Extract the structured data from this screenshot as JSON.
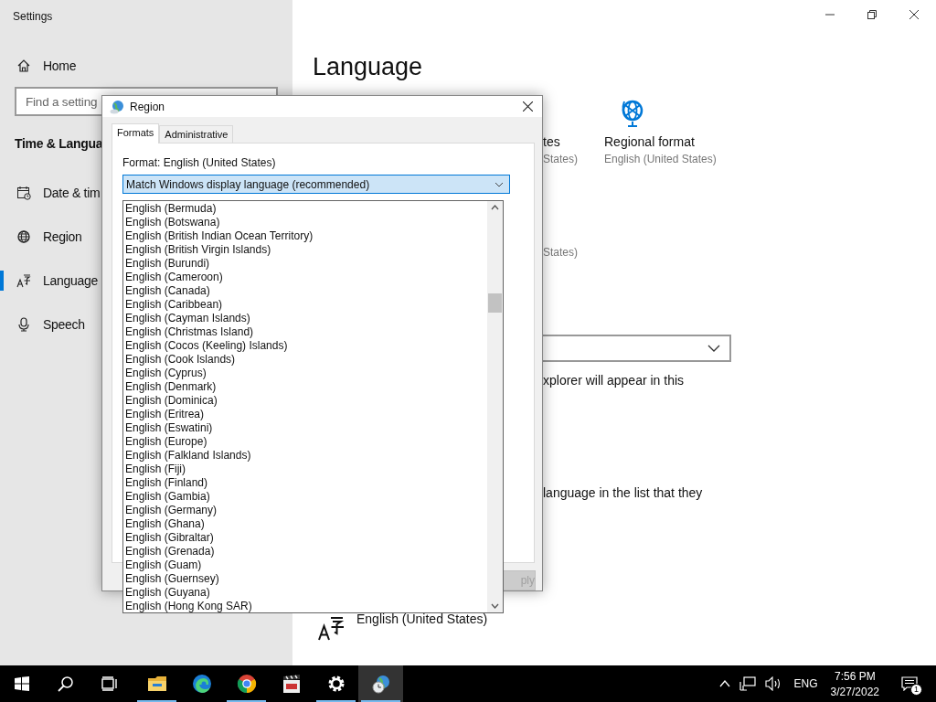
{
  "settings_window": {
    "title": "Settings",
    "sidebar": {
      "home": "Home",
      "search": {
        "placeholder": "Find a setting"
      },
      "section": "Time & Langua",
      "items": [
        {
          "label": "Date & tim",
          "kind": "calendar",
          "selected": false
        },
        {
          "label": "Region",
          "kind": "globe",
          "selected": false
        },
        {
          "label": "Language",
          "kind": "language",
          "selected": true
        },
        {
          "label": "Speech",
          "kind": "microphone",
          "selected": false
        }
      ]
    },
    "main": {
      "title": "Language",
      "tiles": [
        {
          "kind": "fragment",
          "title": "tes",
          "subtitle": "States)"
        },
        {
          "kind": "regional",
          "title": "Regional format",
          "subtitle": "English (United States)"
        }
      ],
      "states_fragment": "States)",
      "note_fragment": "xplorer will appear in this",
      "list_note_fragment": "language in the list that they",
      "language_row": "English (United States)"
    }
  },
  "dialog": {
    "title": "Region",
    "tabs": [
      {
        "label": "Formats",
        "selected": true
      },
      {
        "label": "Administrative",
        "selected": false
      }
    ],
    "format_label": "Format: English (United States)",
    "combo": {
      "value": "Match Windows display language (recommended)",
      "expanded": true
    },
    "options": [
      "English (Bermuda)",
      "English (Botswana)",
      "English (British Indian Ocean Territory)",
      "English (British Virgin Islands)",
      "English (Burundi)",
      "English (Cameroon)",
      "English (Canada)",
      "English (Caribbean)",
      "English (Cayman Islands)",
      "English (Christmas Island)",
      "English (Cocos (Keeling) Islands)",
      "English (Cook Islands)",
      "English (Cyprus)",
      "English (Denmark)",
      "English (Dominica)",
      "English (Eritrea)",
      "English (Eswatini)",
      "English (Europe)",
      "English (Falkland Islands)",
      "English (Fiji)",
      "English (Finland)",
      "English (Gambia)",
      "English (Germany)",
      "English (Ghana)",
      "English (Gibraltar)",
      "English (Grenada)",
      "English (Guam)",
      "English (Guernsey)",
      "English (Guyana)",
      "English (Hong Kong SAR)"
    ],
    "apply_button": {
      "label": "ply",
      "disabled": true
    }
  },
  "taskbar": {
    "apps": [
      {
        "kind": "explorer",
        "running": true,
        "active": false
      },
      {
        "kind": "edge",
        "running": false,
        "active": false
      },
      {
        "kind": "chrome",
        "running": true,
        "active": false
      },
      {
        "kind": "media",
        "running": false,
        "active": false
      },
      {
        "kind": "settings",
        "running": true,
        "active": false
      },
      {
        "kind": "region",
        "running": true,
        "active": true
      }
    ],
    "language": "ENG",
    "time": "7:56 PM",
    "date": "3/27/2022",
    "notification_count": "1"
  }
}
